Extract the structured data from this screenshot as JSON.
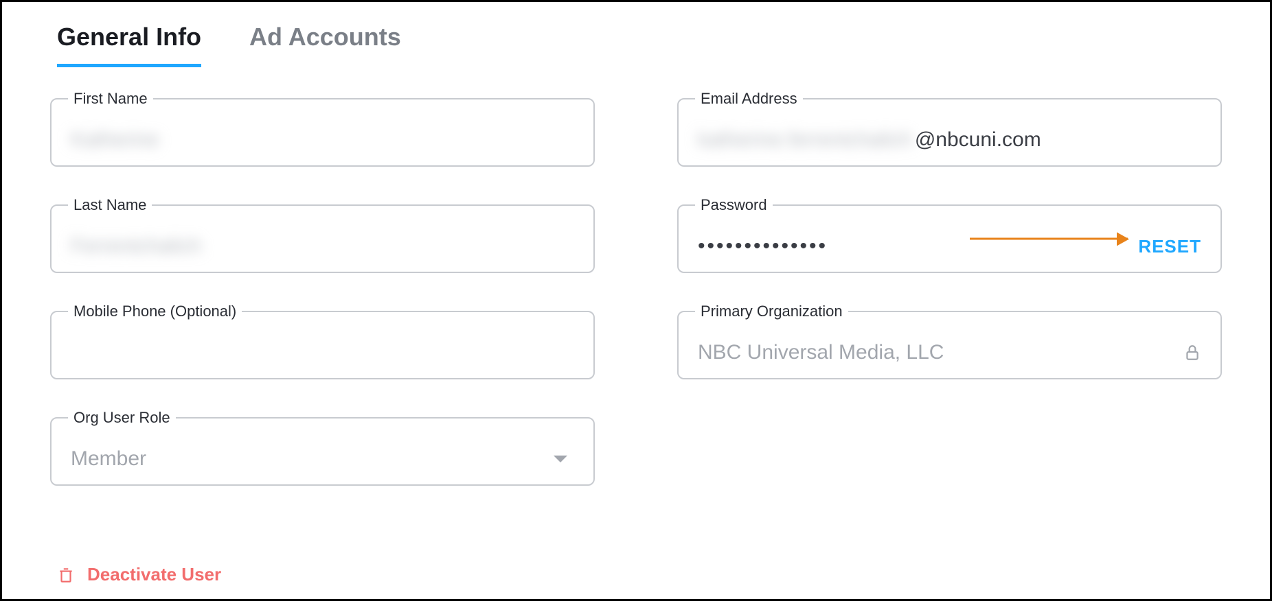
{
  "tabs": {
    "general_info": "General Info",
    "ad_accounts": "Ad Accounts"
  },
  "fields": {
    "first_name": {
      "label": "First Name",
      "value": "Katherine"
    },
    "last_name": {
      "label": "Last Name",
      "value": "Ferrentchalich"
    },
    "mobile_phone": {
      "label": "Mobile Phone (Optional)",
      "value": ""
    },
    "org_user_role": {
      "label": "Org User Role",
      "value": "Member"
    },
    "email": {
      "label": "Email Address",
      "prefix": "katherine.ferrentchalich",
      "suffix": "@nbcuni.com"
    },
    "password": {
      "label": "Password",
      "masked": "••••••••••••••",
      "reset_label": "RESET"
    },
    "primary_org": {
      "label": "Primary Organization",
      "value": "NBC Universal Media, LLC"
    }
  },
  "actions": {
    "deactivate_user": "Deactivate User"
  }
}
